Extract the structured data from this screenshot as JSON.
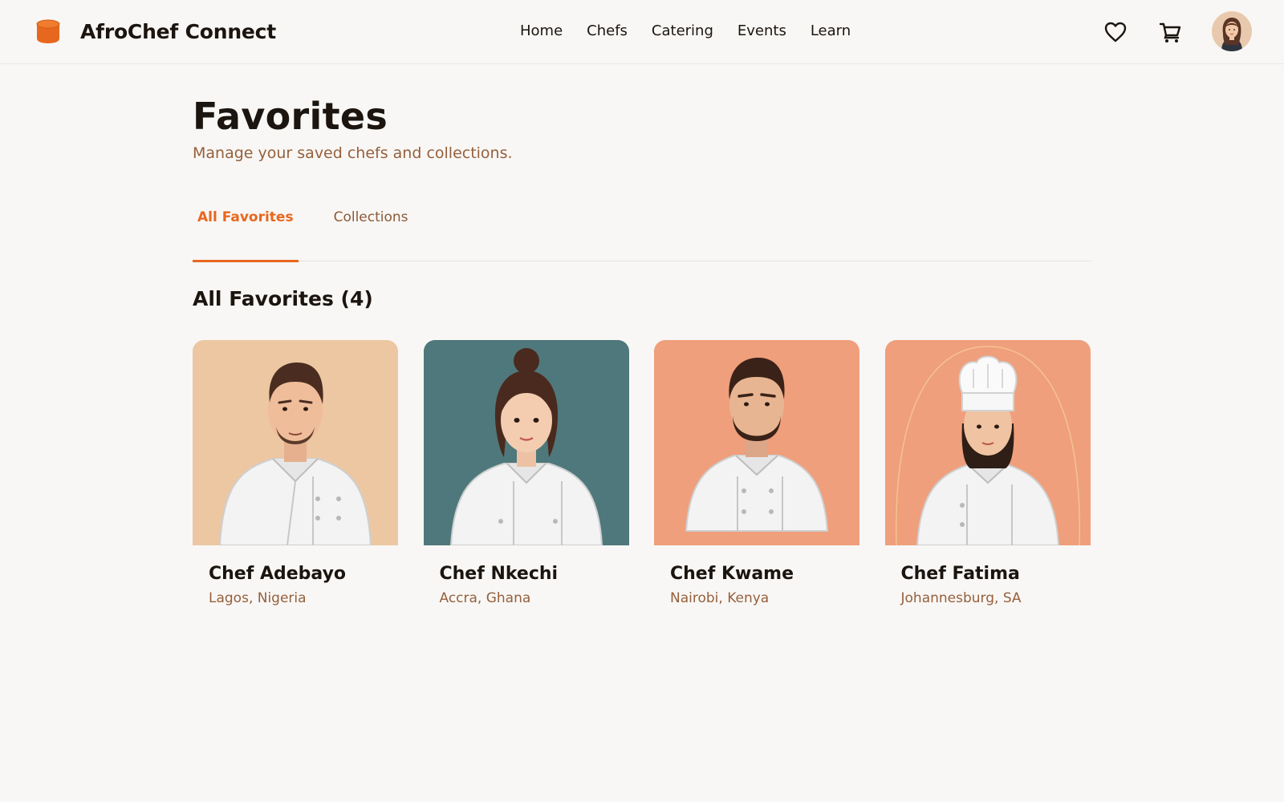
{
  "header": {
    "brand_name": "AfroChef Connect",
    "brand_icon": "logo-icon",
    "nav": [
      "Home",
      "Chefs",
      "Catering",
      "Events",
      "Learn"
    ],
    "icons": [
      "heart-icon",
      "cart-icon"
    ],
    "avatar": "user-avatar"
  },
  "page": {
    "title": "Favorites",
    "subtitle": "Manage your saved chefs and collections."
  },
  "tabs": [
    {
      "label": "All Favorites",
      "active": true
    },
    {
      "label": "Collections",
      "active": false
    }
  ],
  "section": {
    "title": "All Favorites (4)"
  },
  "chefs": [
    {
      "name": "Chef Adebayo",
      "location": "Lagos, Nigeria",
      "bg": "#edc7a2"
    },
    {
      "name": "Chef Nkechi",
      "location": "Accra, Ghana",
      "bg": "#4f787c"
    },
    {
      "name": "Chef Kwame",
      "location": "Nairobi, Kenya",
      "bg": "#ef9f7c"
    },
    {
      "name": "Chef Fatima",
      "location": "Johannesburg, SA",
      "bg": "#ef9f7c"
    }
  ],
  "colors": {
    "accent": "#e8671e",
    "muted_text": "#96603c",
    "background": "#f8f7f5"
  }
}
